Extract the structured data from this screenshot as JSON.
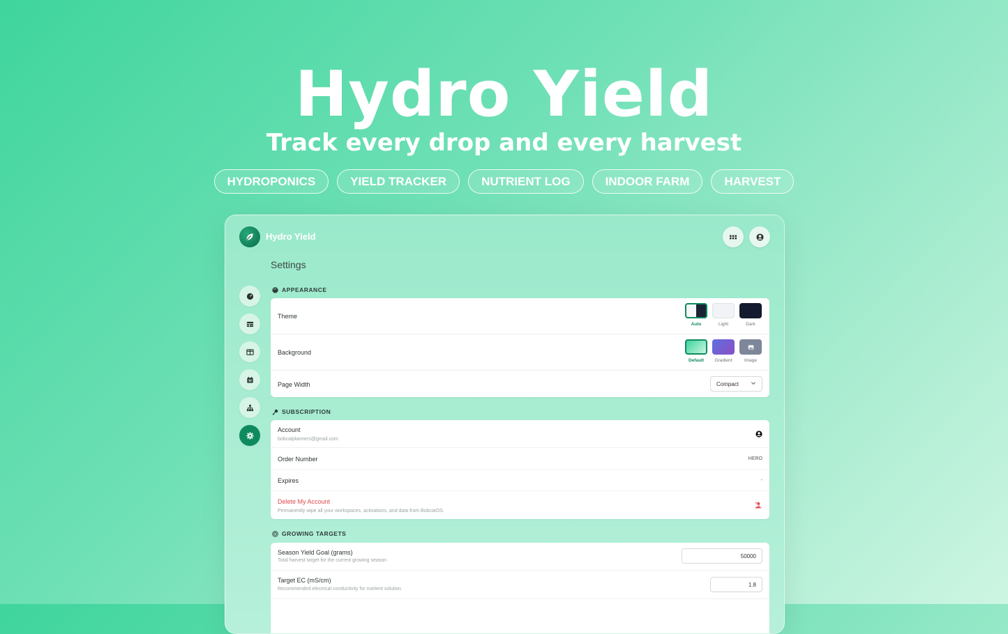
{
  "hero": {
    "title": "Hydro Yield",
    "subtitle": "Track every drop and every harvest",
    "tags": [
      "HYDROPONICS",
      "YIELD TRACKER",
      "NUTRIENT LOG",
      "INDOOR FARM",
      "HARVEST"
    ]
  },
  "app": {
    "name": "Hydro Yield",
    "page_title": "Settings",
    "header_icons": [
      "apps-grid-icon",
      "user-circle-icon"
    ],
    "sidebar": [
      {
        "icon": "dashboard-gauge-icon",
        "active": false
      },
      {
        "icon": "table-icon",
        "active": false
      },
      {
        "icon": "columns-icon",
        "active": false
      },
      {
        "icon": "calendar-icon",
        "active": false
      },
      {
        "icon": "org-chart-icon",
        "active": false
      },
      {
        "icon": "gear-icon",
        "active": true
      }
    ],
    "appearance": {
      "heading": "APPEARANCE",
      "theme_label": "Theme",
      "theme_options": [
        "Auto",
        "Light",
        "Dark"
      ],
      "theme_selected": "Auto",
      "background_label": "Background",
      "background_options": [
        "Default",
        "Gradient",
        "Image"
      ],
      "background_selected": "Default",
      "page_width_label": "Page Width",
      "page_width_value": "Compact"
    },
    "subscription": {
      "heading": "SUBSCRIPTION",
      "account_label": "Account",
      "account_email": "bobcatplanners@gmail.com",
      "order_label": "Order Number",
      "order_value": "HERO",
      "expires_label": "Expires",
      "expires_value": "-",
      "delete_label": "Delete My Account",
      "delete_desc": "Permanently wipe all your workspaces, activations, and data from BobcatOS."
    },
    "growing_targets": {
      "heading": "GROWING TARGETS",
      "yield_label": "Season Yield Goal (grams)",
      "yield_desc": "Total harvest target for the current growing season",
      "yield_value": "50000",
      "ec_label": "Target EC (mS/cm)",
      "ec_desc": "Recommended electrical conductivity for nutrient solution",
      "ec_value": "1.8"
    }
  },
  "colors": {
    "accent": "#0f8a5f",
    "danger": "#e0484d"
  }
}
